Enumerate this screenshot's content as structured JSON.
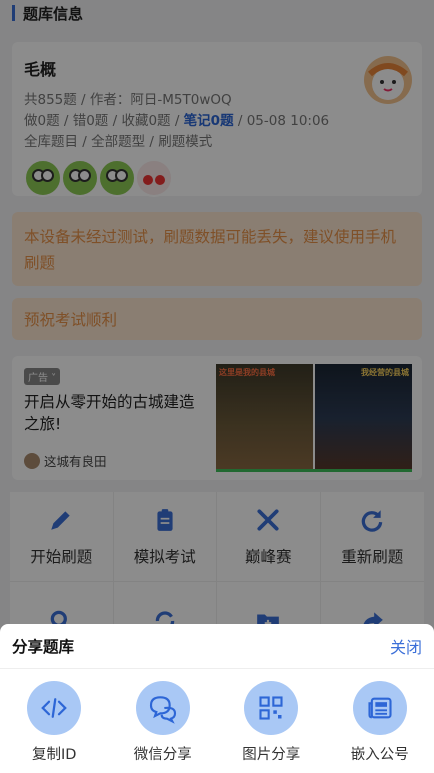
{
  "header": {
    "title": "题库信息"
  },
  "bank": {
    "name": "毛概",
    "line1": "共855题 / 作者：阿日-M5T0wOQ",
    "line2_prefix": "做0题 / 错0题 / 收藏0题 / ",
    "line2_notes": "笔记0题",
    "line2_suffix": " / 05-08 10:06",
    "line3": "全库题目 / 全部题型 / 刷题模式"
  },
  "warning": {
    "text": "本设备未经过测试，刷题数据可能丢失，建议使用手机刷题"
  },
  "wish": {
    "text": "预祝考试顺利"
  },
  "ad": {
    "tag": "广告",
    "title": "开启从零开始的古城建造之旅!",
    "source": "这城有良田",
    "img_left_caption": "这里是我的县城",
    "img_right_caption": "我经营的县城"
  },
  "grid": {
    "items": [
      {
        "label": "开始刷题",
        "icon": "pencil-icon"
      },
      {
        "label": "模拟考试",
        "icon": "clipboard-icon"
      },
      {
        "label": "巅峰赛",
        "icon": "crossed-swords-icon"
      },
      {
        "label": "重新刷题",
        "icon": "redo-icon"
      },
      {
        "label": "",
        "icon": "search-icon"
      },
      {
        "label": "",
        "icon": "sync-icon"
      },
      {
        "label": "",
        "icon": "folder-plus-icon"
      },
      {
        "label": "",
        "icon": "share-icon"
      }
    ]
  },
  "share_sheet": {
    "title": "分享题库",
    "close_label": "关闭",
    "items": [
      {
        "label": "复制ID",
        "icon": "code-icon"
      },
      {
        "label": "微信分享",
        "icon": "chat-icon"
      },
      {
        "label": "图片分享",
        "icon": "qrcode-icon"
      },
      {
        "label": "嵌入公号",
        "icon": "newspaper-icon"
      }
    ]
  },
  "colors": {
    "accent": "#3b6fd8",
    "warning_text": "#e8924a",
    "warning_bg": "#fbe6cf",
    "share_icon_bg": "#a9c8f5"
  }
}
